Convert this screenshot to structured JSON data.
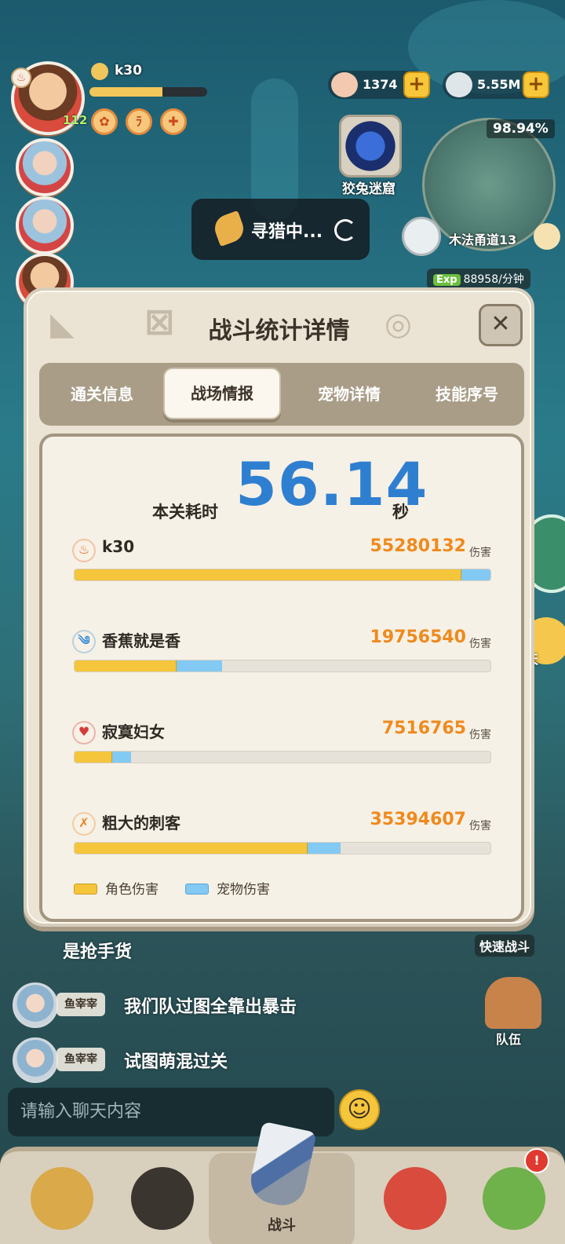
{
  "player": {
    "name": "k30",
    "level": "112",
    "xp_fraction": 0.62
  },
  "currency": {
    "shells": "1374",
    "pearls": "5.55M"
  },
  "map": {
    "progress": "98.94%",
    "region": "木法甬道13",
    "exp_rate": "88958/分钟",
    "exp_tag": "Exp"
  },
  "dungeon": {
    "label": "狡兔迷窟"
  },
  "status": {
    "hunting": "寻猎中..."
  },
  "modal": {
    "title": "战斗统计详情",
    "close": "✕",
    "tabs": [
      "通关信息",
      "战场情报",
      "宠物详情",
      "技能序号"
    ],
    "active_tab": 1,
    "time_label": "本关耗时",
    "time_value": "56.14",
    "time_unit": "秒",
    "damage_unit": "伤害",
    "members": [
      {
        "name": "k30",
        "damage": "55280132",
        "icon_color": "#e96a1f",
        "icon": "fire-class-icon",
        "char_fraction": 0.93,
        "pet_fraction": 0.07
      },
      {
        "name": "香蕉就是香",
        "damage": "19756540",
        "icon_color": "#3b8fd6",
        "icon": "wind-class-icon",
        "char_fraction": 0.245,
        "pet_fraction": 0.11
      },
      {
        "name": "寂寞妇女",
        "damage": "7516765",
        "icon_color": "#d63b3b",
        "icon": "heart-class-icon",
        "char_fraction": 0.09,
        "pet_fraction": 0.045
      },
      {
        "name": "粗大的刺客",
        "damage": "35394607",
        "icon_color": "#e6851f",
        "icon": "dagger-class-icon",
        "char_fraction": 0.56,
        "pet_fraction": 0.08
      }
    ],
    "legend": {
      "character": "角色伤害",
      "pet": "宠物伤害"
    },
    "colors": {
      "character": "#f5c53c",
      "pet": "#82c9f4",
      "damage_text": "#ef8a1e",
      "time": "#2f7fd1"
    }
  },
  "side": {
    "chat": "聊天",
    "quick_battle": "快速战斗",
    "team": "队伍"
  },
  "chat": {
    "partial_line": "是抢手货",
    "messages": [
      {
        "name": "鱼宰宰",
        "text": "我们队过图全靠出暴击"
      },
      {
        "name": "鱼宰宰",
        "text": "试图萌混过关"
      }
    ],
    "input_placeholder": "请输入聊天内容",
    "emoji": "☺"
  },
  "nav": {
    "battle": "战斗",
    "notification": "!"
  }
}
